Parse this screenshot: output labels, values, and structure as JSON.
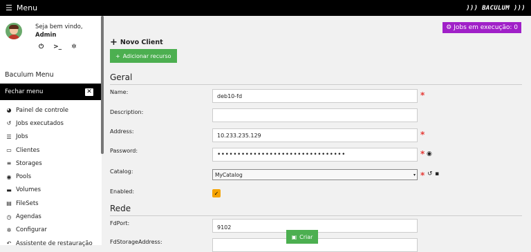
{
  "topbar": {
    "menu_label": "Menu",
    "logo_text": "))) BACULUM )))"
  },
  "user": {
    "welcome": "Seja bem vindo,",
    "name": "Admin"
  },
  "sidebar": {
    "title": "Baculum Menu",
    "close_label": "Fechar menu",
    "items": [
      {
        "label": "Painel de controle",
        "icon": "dashboard-icon",
        "glyph": "◕"
      },
      {
        "label": "Jobs executados",
        "icon": "history-icon",
        "glyph": "↺"
      },
      {
        "label": "Jobs",
        "icon": "list-icon",
        "glyph": "☰"
      },
      {
        "label": "Clientes",
        "icon": "desktop-icon",
        "glyph": "▭"
      },
      {
        "label": "Storages",
        "icon": "database-icon",
        "glyph": "≡"
      },
      {
        "label": "Pools",
        "icon": "pool-icon",
        "glyph": "◉"
      },
      {
        "label": "Volumes",
        "icon": "hdd-icon",
        "glyph": "▬"
      },
      {
        "label": "FileSets",
        "icon": "files-icon",
        "glyph": "▤"
      },
      {
        "label": "Agendas",
        "icon": "clock-icon",
        "glyph": "◷"
      },
      {
        "label": "Configurar",
        "icon": "gear-icon",
        "glyph": "✲"
      },
      {
        "label": "Assistente de restauração",
        "icon": "restore-icon",
        "glyph": "↶"
      }
    ]
  },
  "main": {
    "jobs_badge": "Jobs em execução: 0",
    "page_title": "Novo Client",
    "add_resource_label": "Adicionar recurso",
    "sections": {
      "general": "Geral",
      "network": "Rede"
    },
    "fields": {
      "name": {
        "label": "Name:",
        "value": "deb10-fd"
      },
      "description": {
        "label": "Description:",
        "value": ""
      },
      "address": {
        "label": "Address:",
        "value": "10.233.235.129"
      },
      "password": {
        "label": "Password:",
        "value": "••••••••••••••••••••••••••••••••"
      },
      "catalog": {
        "label": "Catalog:",
        "value": "MyCatalog"
      },
      "enabled": {
        "label": "Enabled:",
        "checked": true
      },
      "fdport": {
        "label": "FdPort:",
        "value": "9102"
      },
      "fdstorageaddress": {
        "label": "FdStorageAddress:",
        "value": ""
      }
    },
    "create_label": "Criar"
  },
  "colors": {
    "accent_green": "#4caf50",
    "badge_purple": "#a020c8",
    "required_red": "#e53935",
    "checkbox_orange": "#f5a300"
  }
}
